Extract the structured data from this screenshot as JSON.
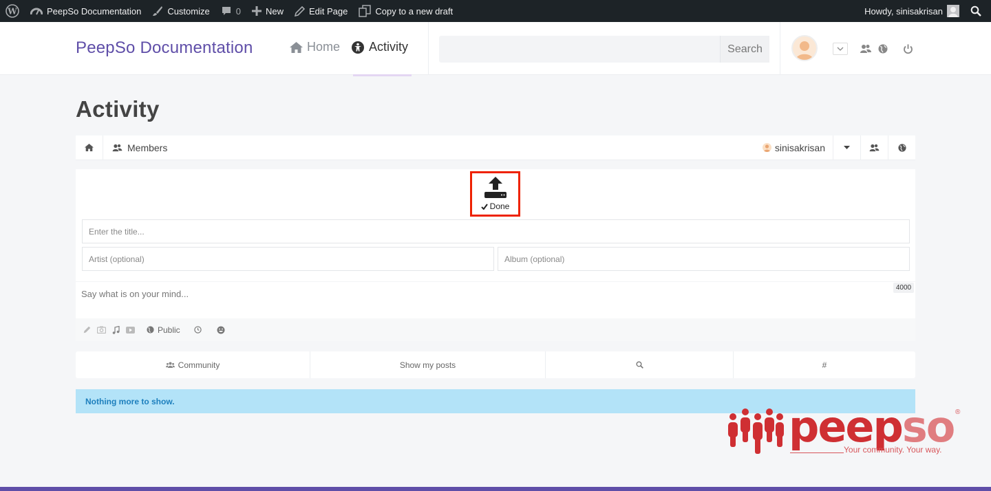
{
  "adminbar": {
    "site_name": "PeepSo Documentation",
    "customize": "Customize",
    "comments_count": "0",
    "new": "New",
    "edit_page": "Edit Page",
    "copy_draft": "Copy to a new draft",
    "howdy": "Howdy, sinisakrisan"
  },
  "header": {
    "site_title": "PeepSo Documentation",
    "nav": {
      "home": "Home",
      "activity": "Activity"
    },
    "search": {
      "placeholder": "",
      "button": "Search"
    }
  },
  "page": {
    "title": "Activity"
  },
  "psnav": {
    "members": "Members",
    "username": "sinisakrisan"
  },
  "postbox": {
    "upload_done": "Done",
    "title_placeholder": "Enter the title...",
    "artist_placeholder": "Artist (optional)",
    "album_placeholder": "Album (optional)",
    "mind_placeholder": "Say what is on your mind...",
    "char_counter": "4000",
    "privacy": "Public"
  },
  "filters": {
    "community": "Community",
    "show_my_posts": "Show my posts",
    "hashtag": "#"
  },
  "notice": "Nothing more to show.",
  "logo": {
    "word_a": "peep",
    "word_b": "so",
    "reg": "®",
    "tagline": "Your community. Your way."
  },
  "colors": {
    "brand": "#5f4ea8",
    "logo_red": "#cf2f33",
    "notice_bg": "#b3e3f8",
    "highlight": "#ee2200"
  }
}
